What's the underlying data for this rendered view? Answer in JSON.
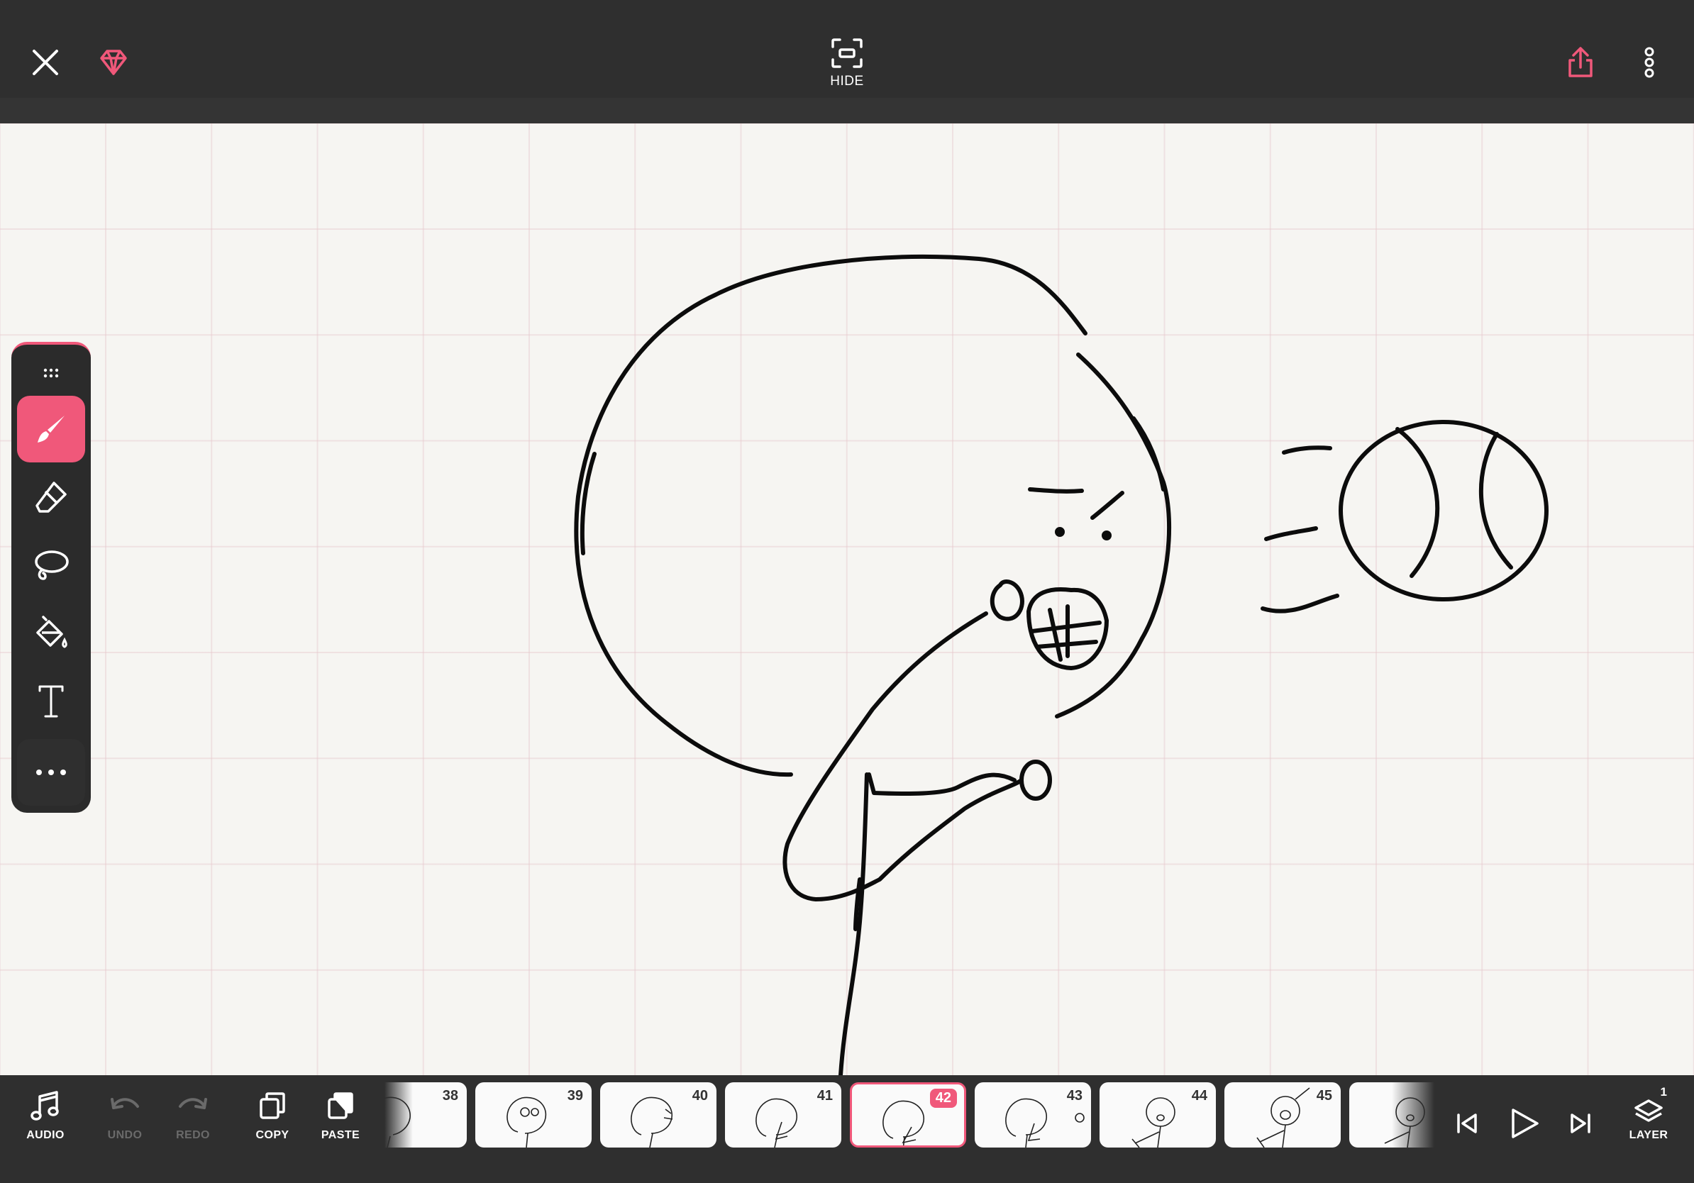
{
  "topbar": {
    "hide_label": "HIDE"
  },
  "colors": {
    "accent": "#f0587a",
    "toolbar_bg": "#2f2f2f",
    "canvas_bg": "#f6f5f2",
    "grid_line": "#ead0d4"
  },
  "tools": [
    {
      "name": "brush",
      "icon": "brush-icon",
      "active": true
    },
    {
      "name": "eraser",
      "icon": "eraser-icon",
      "active": false
    },
    {
      "name": "lasso",
      "icon": "lasso-icon",
      "active": false
    },
    {
      "name": "fill",
      "icon": "paint-bucket-icon",
      "active": false
    },
    {
      "name": "text",
      "icon": "text-icon",
      "active": false
    },
    {
      "name": "more",
      "icon": "more-horizontal-icon",
      "active": false
    }
  ],
  "bottombar": {
    "audio_label": "AUDIO",
    "undo_label": "UNDO",
    "redo_label": "REDO",
    "copy_label": "COPY",
    "paste_label": "PASTE",
    "layer_label": "LAYER",
    "layer_count": "1"
  },
  "frames": [
    {
      "number": "38"
    },
    {
      "number": "39"
    },
    {
      "number": "40"
    },
    {
      "number": "41"
    },
    {
      "number": "42",
      "current": true
    },
    {
      "number": "43"
    },
    {
      "number": "44"
    },
    {
      "number": "45"
    }
  ]
}
